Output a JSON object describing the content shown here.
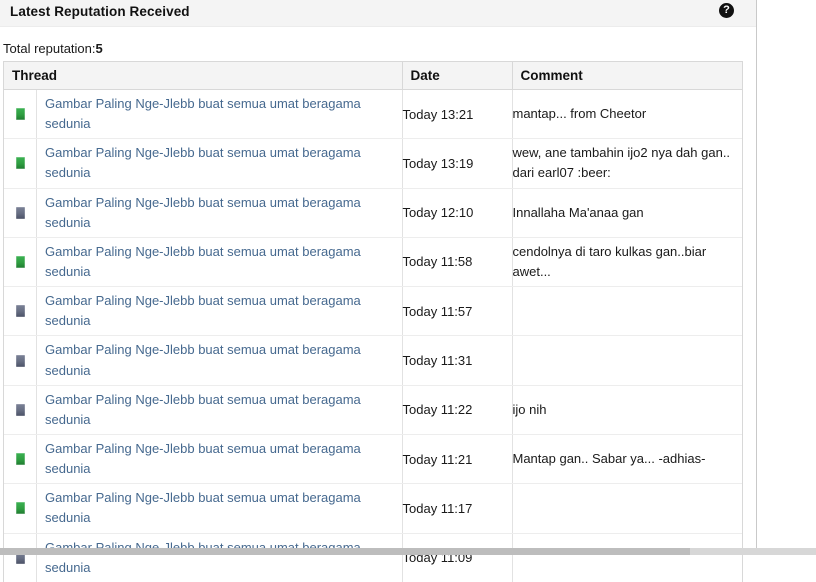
{
  "panel": {
    "title": "Latest Reputation Received",
    "help_icon": "question-mark-circle-icon",
    "total_label": "Total reputation:",
    "total_value": "5"
  },
  "table": {
    "columns": {
      "thread": "Thread",
      "date": "Date",
      "comment": "Comment"
    },
    "rows": [
      {
        "rep": "positive",
        "thread": "Gambar Paling Nge-Jlebb buat semua umat beragama sedunia",
        "date": "Today 13:21",
        "comment": "mantap... from Cheetor"
      },
      {
        "rep": "positive",
        "thread": "Gambar Paling Nge-Jlebb buat semua umat beragama sedunia",
        "date": "Today 13:19",
        "comment": "wew, ane tambahin ijo2 nya dah gan.. dari earl07 :beer:"
      },
      {
        "rep": "neutral",
        "thread": "Gambar Paling Nge-Jlebb buat semua umat beragama sedunia",
        "date": "Today 12:10",
        "comment": "Innallaha Ma'anaa gan"
      },
      {
        "rep": "positive",
        "thread": "Gambar Paling Nge-Jlebb buat semua umat beragama sedunia",
        "date": "Today 11:58",
        "comment": "cendolnya di taro kulkas gan..biar awet..."
      },
      {
        "rep": "neutral",
        "thread": "Gambar Paling Nge-Jlebb buat semua umat beragama sedunia",
        "date": "Today 11:57",
        "comment": ""
      },
      {
        "rep": "neutral",
        "thread": "Gambar Paling Nge-Jlebb buat semua umat beragama sedunia",
        "date": "Today 11:31",
        "comment": ""
      },
      {
        "rep": "neutral",
        "thread": "Gambar Paling Nge-Jlebb buat semua umat beragama sedunia",
        "date": "Today 11:22",
        "comment": "ijo nih"
      },
      {
        "rep": "positive",
        "thread": "Gambar Paling Nge-Jlebb buat semua umat beragama sedunia",
        "date": "Today 11:21",
        "comment": "Mantap gan.. Sabar ya... -adhias-"
      },
      {
        "rep": "positive",
        "thread": "Gambar Paling Nge-Jlebb buat semua umat beragama sedunia",
        "date": "Today 11:17",
        "comment": ""
      },
      {
        "rep": "neutral",
        "thread": "Gambar Paling Nge-Jlebb buat semua umat beragama sedunia",
        "date": "Today 11:09",
        "comment": ""
      }
    ]
  },
  "colors": {
    "positive": "#2f9e41",
    "neutral": "#666d82",
    "link": "#46698f",
    "header_bg": "#f4f4f4",
    "border": "#d8d8d8"
  }
}
